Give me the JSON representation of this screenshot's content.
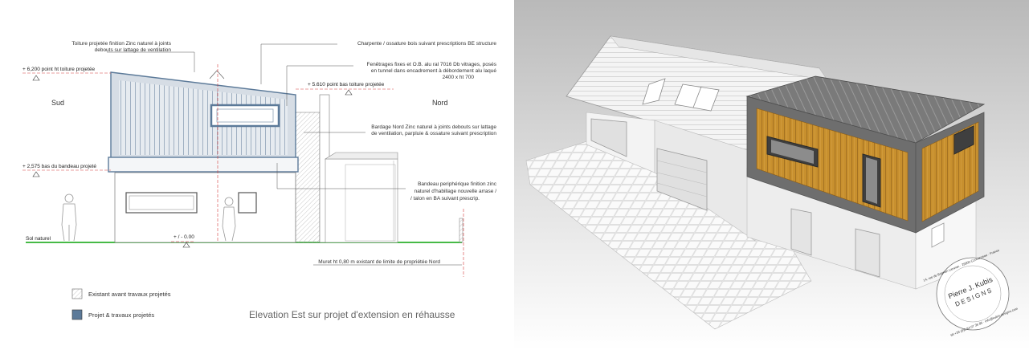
{
  "elevation": {
    "annotations": {
      "roof_finish": [
        "Toiture projetée finition Zinc naturel à joints",
        "debouts sur lattage de ventilation"
      ],
      "framing": "Charpente  / ossature bois  suivant prescriptions BE structure",
      "windows": [
        "Fenêtrages fixes et O.B. alu ral 7016  Db vitrages, posés",
        "en tunnel  dans encadrement à débordement alu laqué",
        "2400 x ht 700"
      ],
      "cladding": [
        "Bardage Nord Zinc naturel à joints debouts sur lattage",
        "de ventilation, parpluie & ossature suivant prescription"
      ],
      "band": [
        "Bandeau periphérique finition zinc",
        "naturel d'habillage nouvelle arrase /",
        "/ talon en BA suivant prescrip."
      ],
      "wall": "Muret ht 0,80 m existant de limite de propriétée Nord"
    },
    "levels": {
      "roof_top": "+ 6,200  point ht toiture projetée",
      "roof_low": "+ 5.610  point bas toiture projetée",
      "band": "+ 2,575  bas du bandeau projeté",
      "zero": "+ / - 0.00",
      "ground": "Sol naturel"
    },
    "orientation": {
      "south": "Sud",
      "north": "Nord"
    },
    "legend": {
      "existing": "Existant avant travaux projetés",
      "project": "Projet & travaux projetés"
    },
    "title": "Elevation Est sur projet d'extension en réhausse"
  },
  "logo": {
    "name_line1": "Pierre J. Kubis",
    "name_line2": "DESIGNS",
    "address": "14, rue de Brignan Lanvian · 29900 Concarneau · France",
    "contact": "tél +33 (0)6 84 07 36 85 · info@kubis-designs.com"
  },
  "colors": {
    "project_blue": "#5c7a99",
    "ground_green": "#2db12d",
    "dim_red": "#d43a3a",
    "cladding_wood": "#c8902e",
    "zinc_dark": "#6e6e6e"
  }
}
